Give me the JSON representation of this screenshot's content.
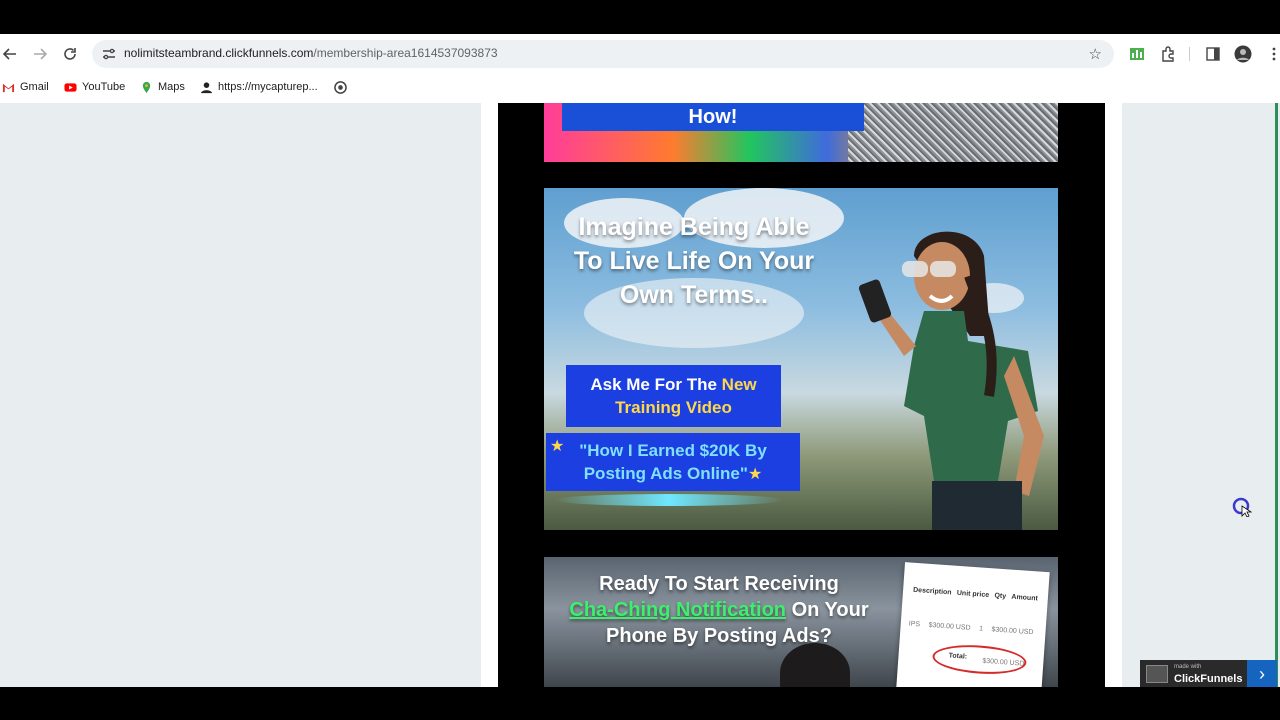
{
  "browser": {
    "url_host": "nolimitsteambrand.clickfunnels.com",
    "url_path": "/membership-area1614537093873",
    "bookmarks": [
      {
        "label": "Gmail",
        "icon": "gmail-icon"
      },
      {
        "label": "YouTube",
        "icon": "youtube-icon"
      },
      {
        "label": "Maps",
        "icon": "maps-pin-icon"
      },
      {
        "label": "https://mycapturep...",
        "icon": "person-icon"
      }
    ]
  },
  "content": {
    "top_banner": "How!",
    "promo": {
      "headline": [
        "Imagine Being Able",
        "To Live Life On Your",
        "Own Terms.."
      ],
      "ask_prefix": "Ask Me For The ",
      "ask_highlight": "New",
      "ask_line2": "Training Video",
      "earned_line1": "\"How I Earned $20K By",
      "earned_line2": "Posting Ads Online\""
    },
    "cta": {
      "line1": "Ready To Start Receiving",
      "green": "Cha-Ching Notification",
      "line2_rest": " On Your",
      "line3": "Phone By Posting Ads?",
      "invoice": {
        "headers": [
          "Description",
          "Unit price",
          "Qty",
          "Amount"
        ],
        "row": [
          "IPS",
          "$300.00 USD",
          "1",
          "$300.00 USD"
        ],
        "total_label": "Total:",
        "total_value": "$300.00 USD"
      }
    }
  },
  "badge": {
    "made_with": "made with",
    "name": "ClickFunnels"
  },
  "colors": {
    "accent_blue": "#1b3fe0",
    "highlight_yellow": "#ffd84a",
    "cha_ching_green": "#3bf06a"
  }
}
